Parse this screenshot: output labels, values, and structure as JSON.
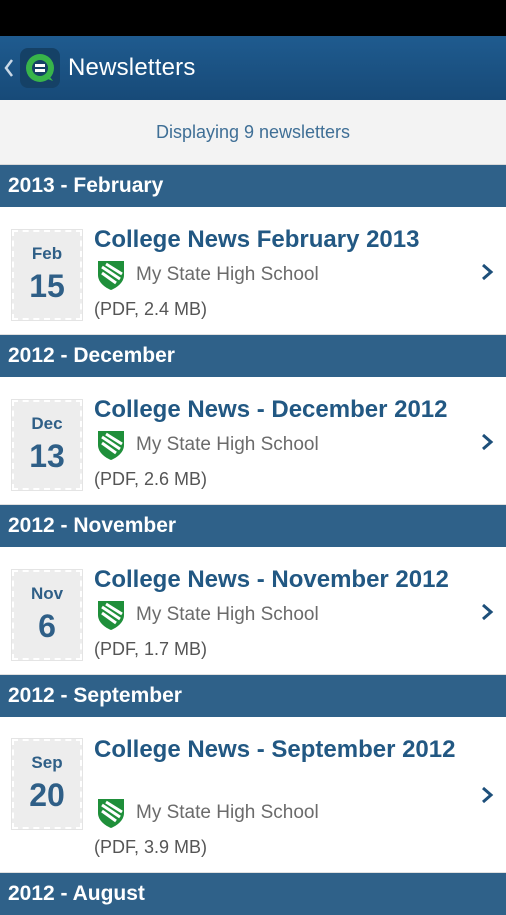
{
  "app": {
    "title": "Newsletters"
  },
  "summary": {
    "text": "Displaying 9 newsletters"
  },
  "colors": {
    "appbar": "#1f5b8f",
    "header": "#2f6189",
    "title": "#225883",
    "accent_green": "#1f8f3a"
  },
  "groups": [
    {
      "header": "2013 - February",
      "month": "Feb",
      "day": "15",
      "title": "College News February 2013",
      "school": "My State High School",
      "file": "(PDF, 2.4 MB)"
    },
    {
      "header": "2012 - December",
      "month": "Dec",
      "day": "13",
      "title": "College News - December 2012",
      "school": "My State High School",
      "file": "(PDF, 2.6 MB)"
    },
    {
      "header": "2012 - November",
      "month": "Nov",
      "day": "6",
      "title": "College News - November 2012",
      "school": "My State High School",
      "file": "(PDF, 1.7 MB)"
    },
    {
      "header": "2012 - September",
      "month": "Sep",
      "day": "20",
      "title": "College News - September 2012",
      "school": "My State High School",
      "file": "(PDF, 3.9 MB)"
    },
    {
      "header": "2012 - August"
    }
  ],
  "icons": {
    "back": "chevron-left-icon",
    "logo": "app-logo-icon",
    "school": "shield-icon",
    "open": "chevron-right-icon"
  }
}
